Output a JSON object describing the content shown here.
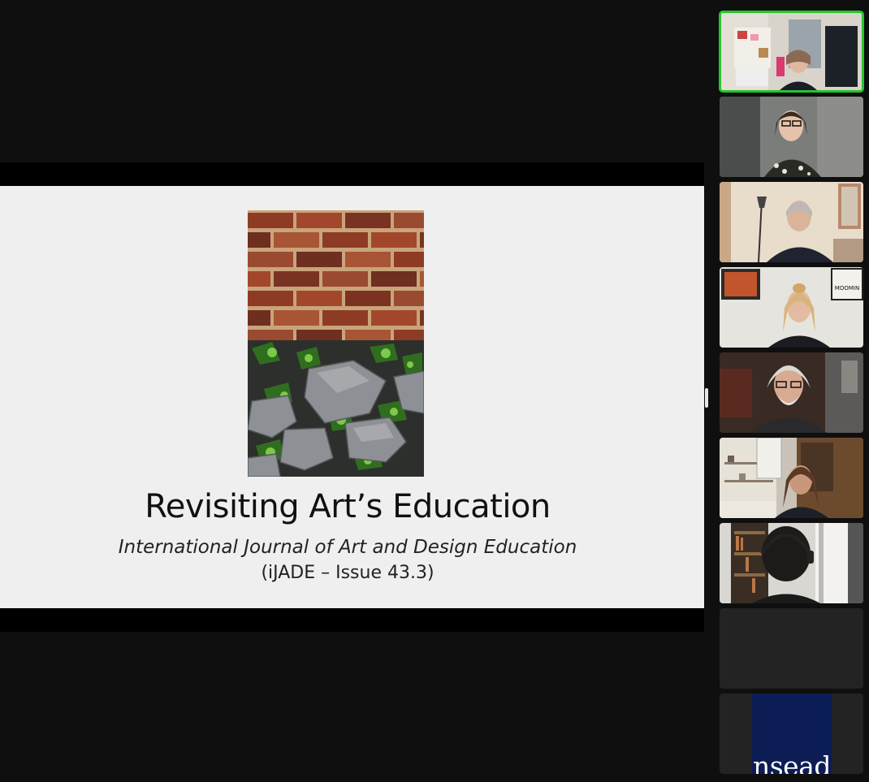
{
  "slide": {
    "title": "Revisiting Art’s Education",
    "subtitle": "International Journal of Art and Design Education",
    "issue": "(iJADE – Issue 43.3)",
    "photo_icon": "brick-wall-rocks-photo"
  },
  "gallery": {
    "active_speaker_color": "#27c52d",
    "tiles": [
      {
        "name": "participant-1",
        "active": true
      },
      {
        "name": "participant-2",
        "active": false
      },
      {
        "name": "participant-3",
        "active": false
      },
      {
        "name": "participant-4",
        "active": false
      },
      {
        "name": "participant-5",
        "active": false
      },
      {
        "name": "participant-6",
        "active": false
      },
      {
        "name": "participant-7",
        "active": false
      },
      {
        "name": "participant-8",
        "active": false
      },
      {
        "name": "participant-9",
        "active": false
      }
    ],
    "logo_text": "nsead"
  }
}
